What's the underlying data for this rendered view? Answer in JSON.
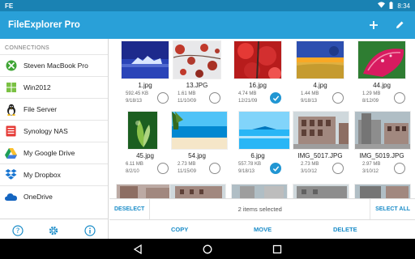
{
  "status": {
    "carrier": "FE",
    "time": "8:34"
  },
  "app": {
    "title": "FileExplorer Pro"
  },
  "sidebar": {
    "header": "CONNECTIONS",
    "items": [
      {
        "label": "Steven MacBook Pro",
        "icon": "xbox-icon"
      },
      {
        "label": "Win2012",
        "icon": "windows-icon"
      },
      {
        "label": "File Server",
        "icon": "linux-tux-icon"
      },
      {
        "label": "Synology NAS",
        "icon": "nas-icon"
      },
      {
        "label": "My Google Drive",
        "icon": "google-drive-icon"
      },
      {
        "label": "My Dropbox",
        "icon": "dropbox-icon"
      },
      {
        "label": "OneDrive",
        "icon": "onedrive-icon"
      }
    ]
  },
  "files": [
    {
      "name": "1.jpg",
      "size": "592.45 KB",
      "date": "9/18/13",
      "selected": false
    },
    {
      "name": "13.JPG",
      "size": "1.61 MB",
      "date": "11/10/09",
      "selected": false
    },
    {
      "name": "16.jpg",
      "size": "4.74 MB",
      "date": "12/21/09",
      "selected": true
    },
    {
      "name": "4.jpg",
      "size": "1.44 MB",
      "date": "9/18/13",
      "selected": false
    },
    {
      "name": "44.jpg",
      "size": "1.29 MB",
      "date": "8/12/09",
      "selected": false
    },
    {
      "name": "45.jpg",
      "size": "6.11 MB",
      "date": "8/2/10",
      "selected": false
    },
    {
      "name": "54.jpg",
      "size": "2.73 MB",
      "date": "11/15/09",
      "selected": false
    },
    {
      "name": "6.jpg",
      "size": "557.78 KB",
      "date": "9/18/13",
      "selected": true
    },
    {
      "name": "IMG_5017.JPG",
      "size": "2.73 MB",
      "date": "3/10/12",
      "selected": false
    },
    {
      "name": "IMG_5019.JPG",
      "size": "2.97 MB",
      "date": "3/10/12",
      "selected": false
    }
  ],
  "selection": {
    "deselect": "DESELECT",
    "info": "2 items selected",
    "select_all": "SELECT ALL"
  },
  "actions": {
    "copy": "COPY",
    "move": "MOVE",
    "delete": "DELETE"
  },
  "colors": {
    "accent": "#29a0d8",
    "status_bar": "#1a82b3",
    "link": "#1a8cc8"
  }
}
